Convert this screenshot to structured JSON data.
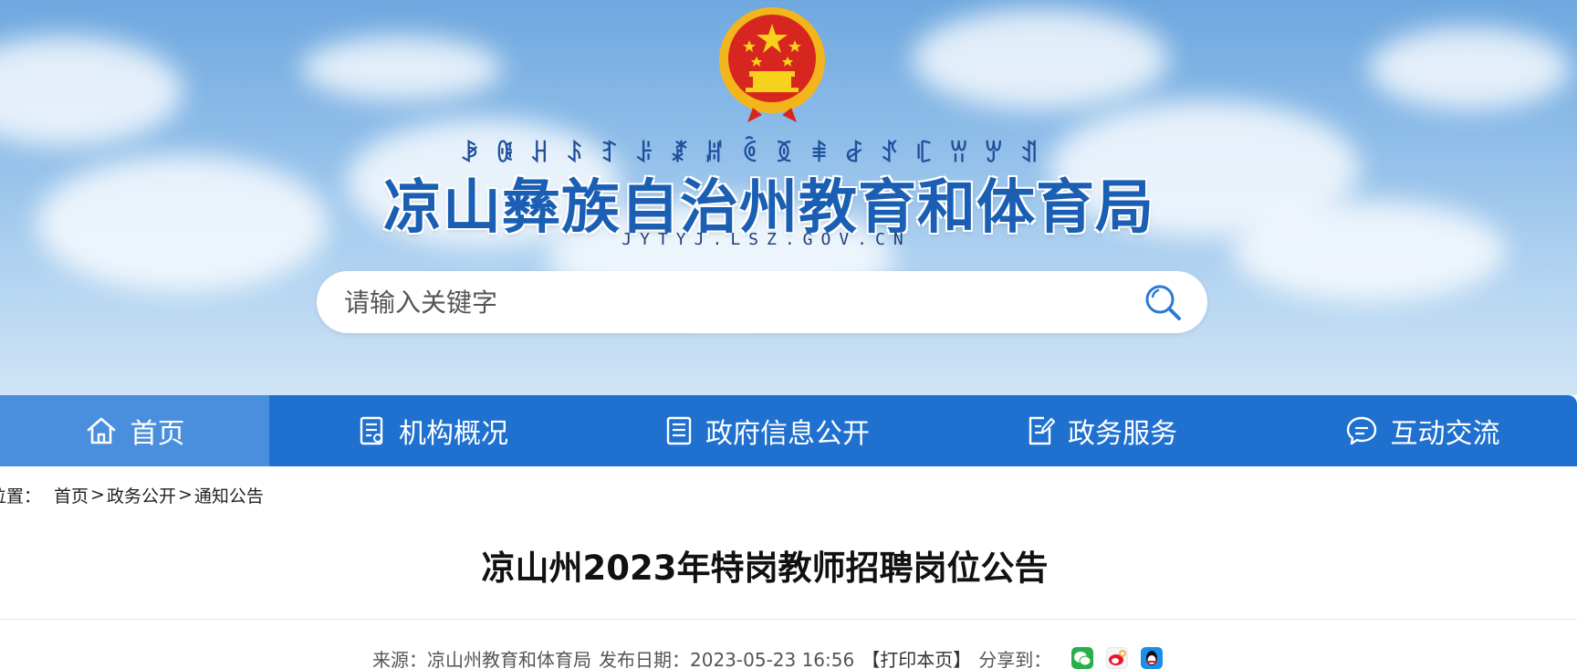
{
  "header": {
    "yi_script": "ꆃꍆꃅꌺꆈꌠꊨꏦꏱꅉꑌꆀꀋꏸꀕꏮꀊ",
    "site_title": "凉山彝族自治州教育和体育局",
    "site_domain": "JYTYJ.LSZ.GOV.CN",
    "emblem": "national-emblem-icon"
  },
  "search": {
    "placeholder": "请输入关键字",
    "icon": "search-icon"
  },
  "nav": {
    "items": [
      {
        "label": "首页",
        "icon": "home-icon",
        "active": true
      },
      {
        "label": "机构概况",
        "icon": "document-icon"
      },
      {
        "label": "政府信息公开",
        "icon": "list-doc-icon"
      },
      {
        "label": "政务服务",
        "icon": "edit-doc-icon"
      },
      {
        "label": "互动交流",
        "icon": "chat-icon"
      }
    ],
    "colors": {
      "bar": "#1f70cf",
      "active": "#4a8fdd"
    }
  },
  "breadcrumb": {
    "prefix": "位置：",
    "items": [
      "首页",
      "政务公开",
      "通知公告"
    ],
    "separator": ">"
  },
  "article": {
    "title": "凉山州2023年特岗教师招聘岗位公告",
    "source": "来源：凉山州教育和体育局",
    "date": "发布日期：2023-05-23 16:56",
    "print": "【打印本页】",
    "share_label": "分享到：",
    "share_icons": [
      "wechat-icon",
      "weibo-icon",
      "qq-icon"
    ]
  }
}
